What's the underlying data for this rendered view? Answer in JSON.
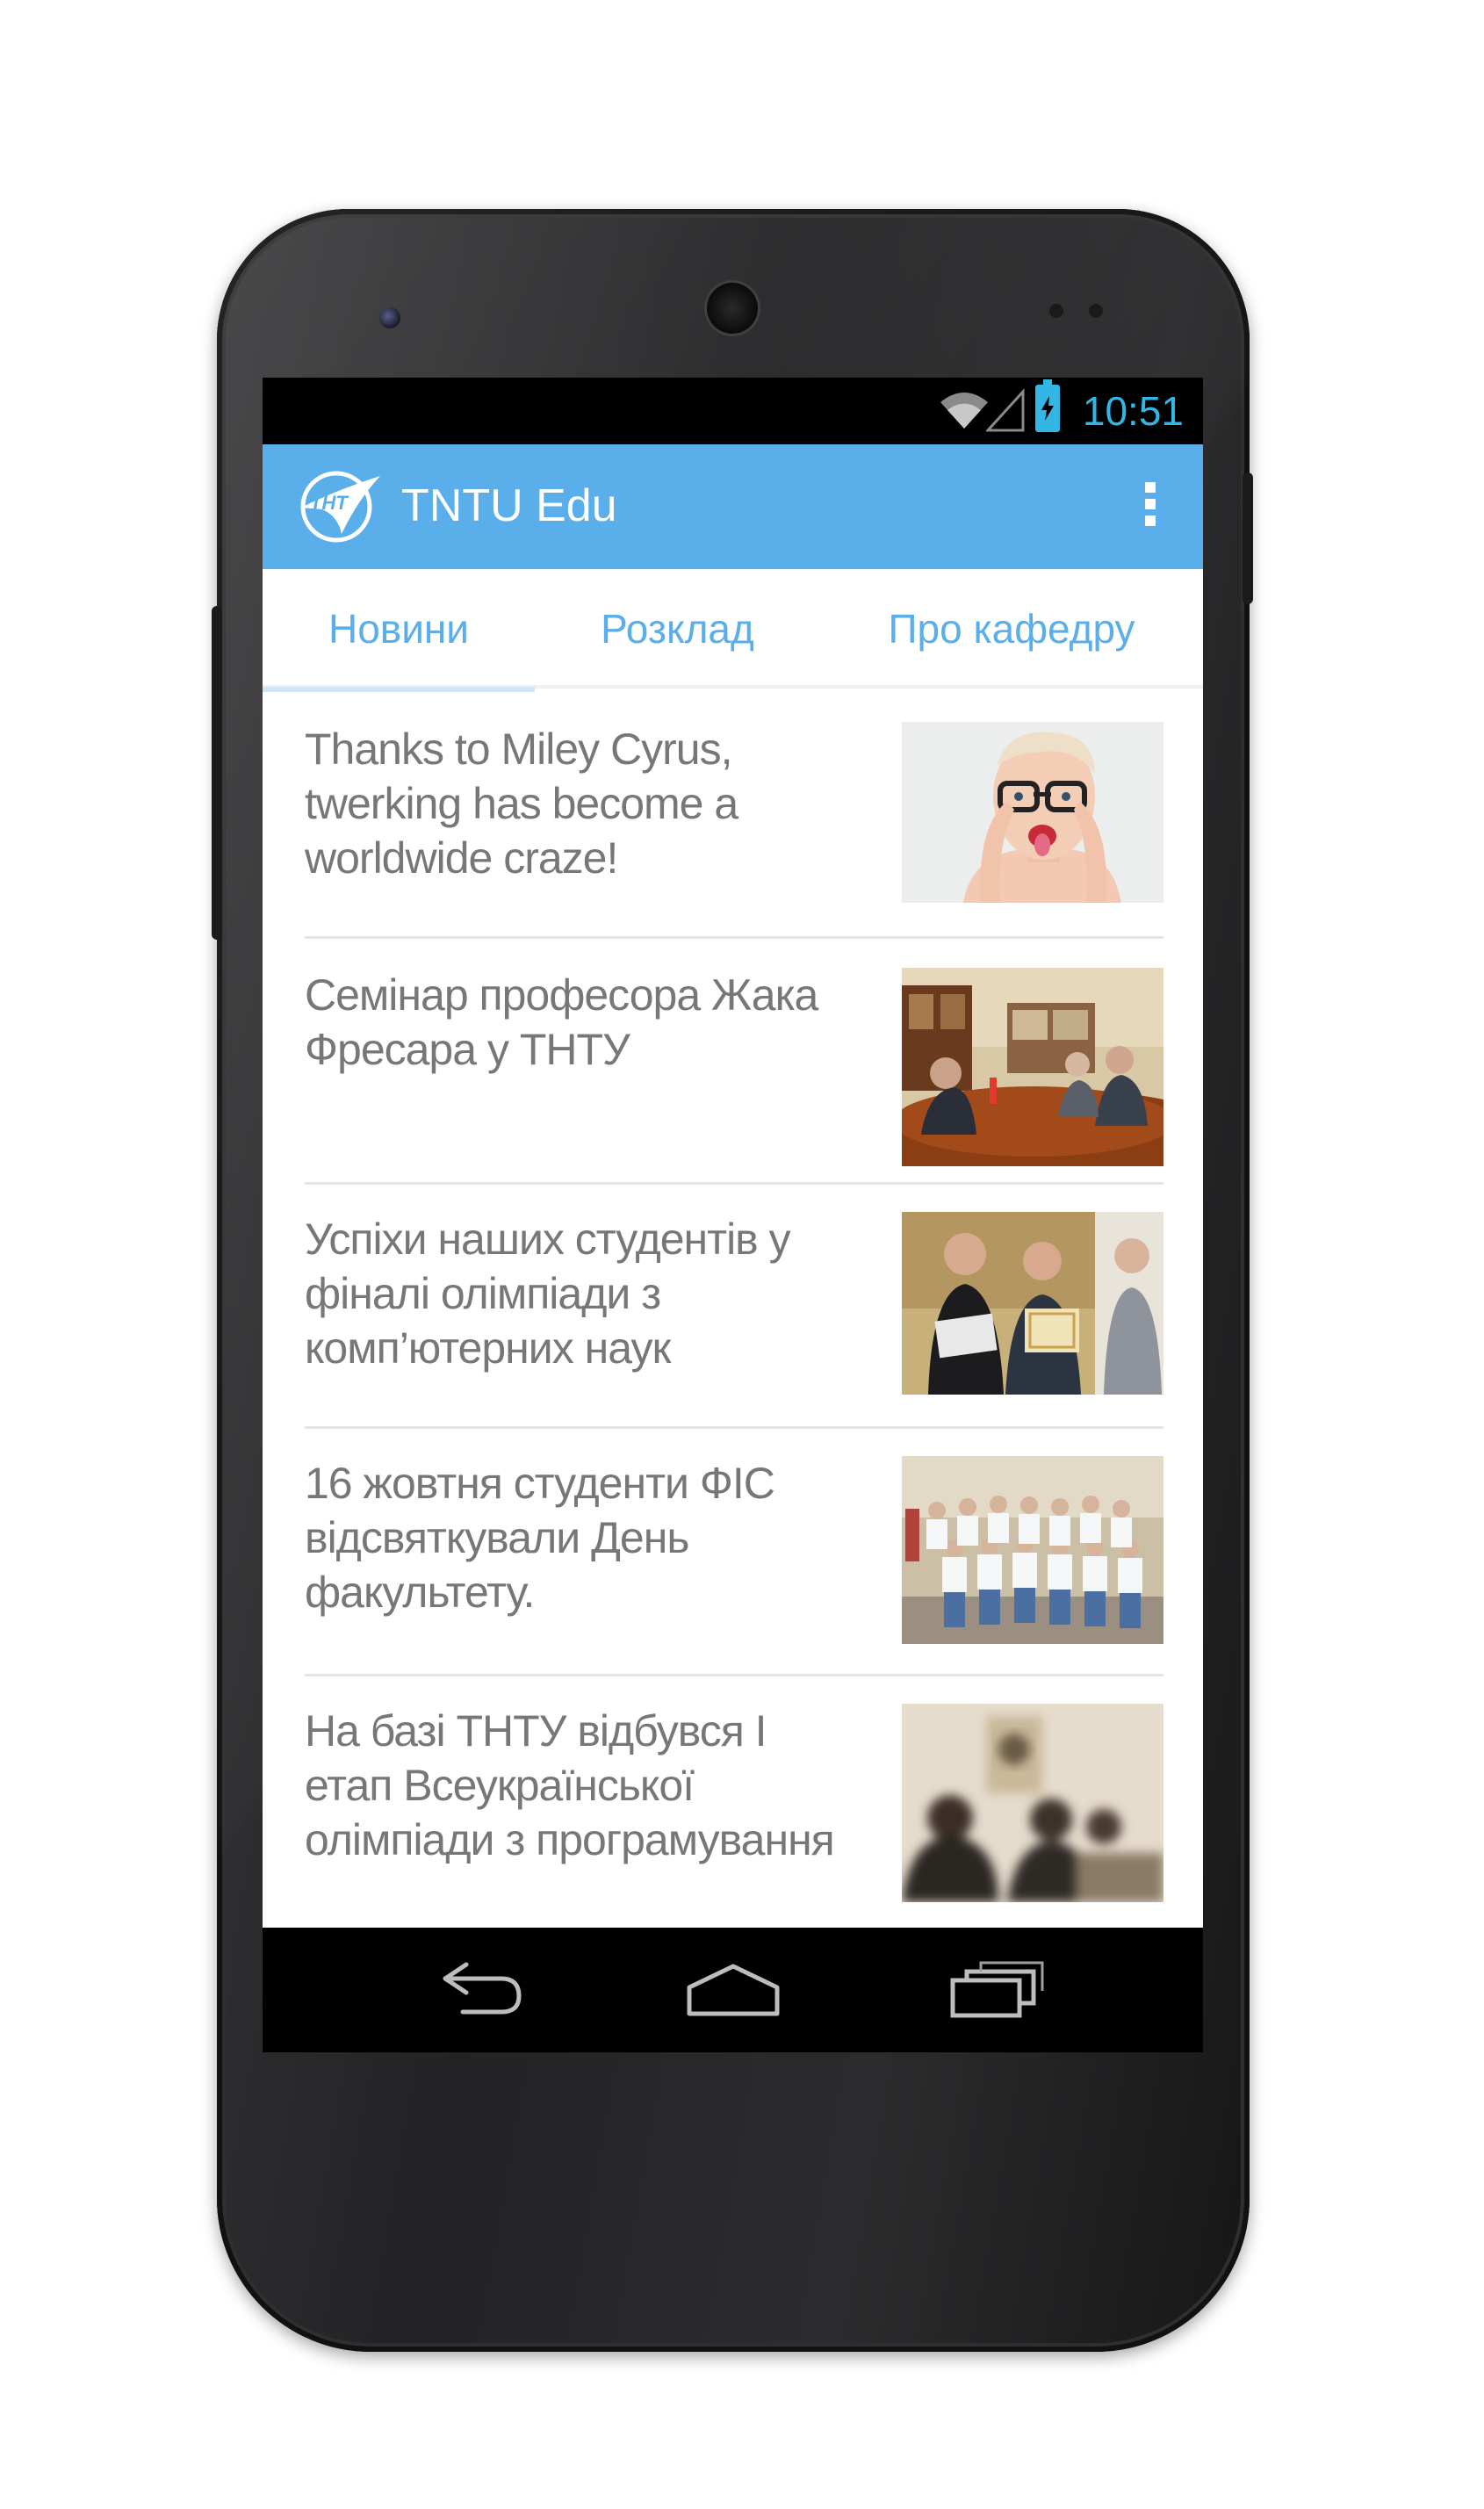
{
  "status_bar": {
    "time": "10:51",
    "time_color": "#33b5e5",
    "icons": [
      "wifi-icon",
      "signal-icon",
      "battery-charging-icon"
    ]
  },
  "app_bar": {
    "title": "TNTU Edu",
    "logo_text": "ТНТ",
    "background": "#5aaeea",
    "overflow_icon": "more-vert-icon"
  },
  "tabs": [
    {
      "label": "Новини",
      "active": true
    },
    {
      "label": "Розклад",
      "active": false
    },
    {
      "label": "Про кафедру",
      "active": false
    }
  ],
  "news": [
    {
      "title": "Thanks to Miley Cyrus, twerking has become a worldwide craze!",
      "image": "portrait-photo"
    },
    {
      "title": "Семінар професора Жака Фресара у ТНТУ",
      "image": "meeting-photo"
    },
    {
      "title": "Успіхи наших студентів у фіналі олімпіади з комп’ютерних наук",
      "image": "award-photo"
    },
    {
      "title": "16 жовтня студенти ФІС відсвяткували День факультету.",
      "image": "group-photo"
    },
    {
      "title": "На базі ТНТУ відбувся І етап Всеукраїнської олімпіади з програмування",
      "image": "contest-photo"
    }
  ],
  "nav_bar": {
    "buttons": [
      "back-icon",
      "home-icon",
      "recents-icon"
    ]
  }
}
